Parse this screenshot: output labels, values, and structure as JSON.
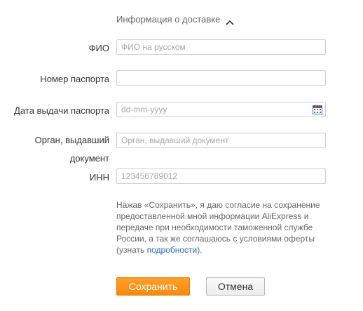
{
  "section": {
    "title": "Информация о доставке",
    "toggle_icon": "chevron-up-icon"
  },
  "form": {
    "fio": {
      "label": "ФИО",
      "placeholder": "ФИО на русском",
      "value": ""
    },
    "passport": {
      "label": "Номер паспорта",
      "placeholder": "",
      "value": ""
    },
    "issue_date": {
      "label": "Дата выдачи паспорта",
      "placeholder": "dd-mm-yyyy",
      "value": "",
      "icon": "calendar-icon"
    },
    "authority": {
      "label_line1": "Орган, выдавший",
      "label_line2": "документ",
      "placeholder": "Орган, выдавший документ",
      "value": ""
    },
    "inn": {
      "label": "ИНН",
      "placeholder": "123456789012",
      "value": ""
    }
  },
  "consent": {
    "text_before": "Нажав «Сохранить», я даю согласие на сохранение предоставленной мной информации AliExpress и передаче при необходимости таможенной службе России, а так же соглашаюсь с условиями оферты (узнать ",
    "link_text": "подробности",
    "text_after": ")."
  },
  "buttons": {
    "save_label": "Сохранить",
    "cancel_label": "Отмена"
  },
  "colors": {
    "accent": "#f78a10",
    "link": "#2a6fb5"
  }
}
